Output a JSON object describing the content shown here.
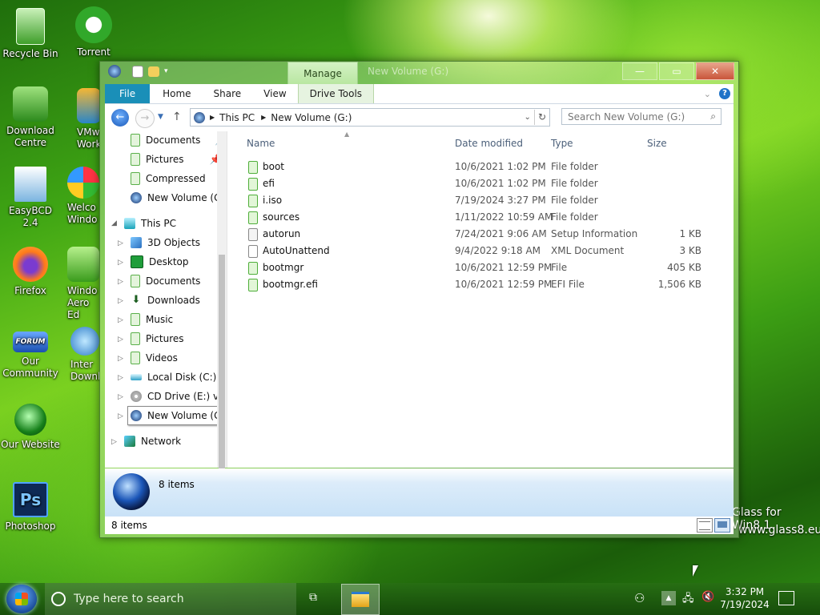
{
  "desktop": {
    "icons": [
      {
        "label": "Recycle Bin",
        "icon": "recycle-bin-icon"
      },
      {
        "label": "Torrent",
        "icon": "torrent-icon"
      },
      {
        "label": "Download Centre",
        "icon": "download-centre-icon"
      },
      {
        "label": "VMw Workst",
        "icon": "vmware-icon"
      },
      {
        "label": "EasyBCD 2.4",
        "icon": "easybcd-icon"
      },
      {
        "label": "Welco Windo",
        "icon": "welcome-icon"
      },
      {
        "label": "Firefox",
        "icon": "firefox-icon"
      },
      {
        "label": "Windo Aero Ed",
        "icon": "aero-icon"
      },
      {
        "label": "Our Community",
        "icon": "forum-icon"
      },
      {
        "label": "Inter Downl",
        "icon": "internet-download-icon"
      },
      {
        "label": "Our Website",
        "icon": "website-icon"
      },
      {
        "label": "Photoshop",
        "icon": "photoshop-icon"
      }
    ],
    "forum_badge": "FORUM",
    "ps_badge": "Ps",
    "watermark_line1": "Glass for Win8.1",
    "watermark_line2": "www.glass8.eu"
  },
  "window": {
    "title": "New Volume (G:)",
    "contextual_tab_group": "Manage",
    "ribbon_tabs": [
      "File",
      "Home",
      "Share",
      "View",
      "Drive Tools"
    ],
    "address": {
      "root": "This PC",
      "current": "New Volume (G:)"
    },
    "search_placeholder": "Search New Volume (G:)",
    "nav": {
      "quick_access": [
        "Documents",
        "Pictures",
        "Compressed",
        "New Volume (G:"
      ],
      "this_pc": "This PC",
      "this_pc_items": [
        "3D Objects",
        "Desktop",
        "Documents",
        "Downloads",
        "Music",
        "Pictures",
        "Videos",
        "Local Disk (C:)",
        "CD Drive (E:) virt",
        "New Volume (G:)"
      ],
      "network": "Network"
    },
    "columns": {
      "name": "Name",
      "date": "Date modified",
      "type": "Type",
      "size": "Size"
    },
    "files": [
      {
        "name": "boot",
        "date": "10/6/2021 1:02 PM",
        "type": "File folder",
        "size": ""
      },
      {
        "name": "efi",
        "date": "10/6/2021 1:02 PM",
        "type": "File folder",
        "size": ""
      },
      {
        "name": "i.iso",
        "date": "7/19/2024 3:27 PM",
        "type": "File folder",
        "size": ""
      },
      {
        "name": "sources",
        "date": "1/11/2022 10:59 AM",
        "type": "File folder",
        "size": ""
      },
      {
        "name": "autorun",
        "date": "7/24/2021 9:06 AM",
        "type": "Setup Information",
        "size": "1 KB"
      },
      {
        "name": "AutoUnattend",
        "date": "9/4/2022 9:18 AM",
        "type": "XML Document",
        "size": "3 KB"
      },
      {
        "name": "bootmgr",
        "date": "10/6/2021 12:59 PM",
        "type": "File",
        "size": "405 KB"
      },
      {
        "name": "bootmgr.efi",
        "date": "10/6/2021 12:59 PM",
        "type": "EFI File",
        "size": "1,506 KB"
      }
    ],
    "details_count": "8 items",
    "status_count": "8 items"
  },
  "taskbar": {
    "search_placeholder": "Type here to search",
    "time": "3:32 PM",
    "date": "7/19/2024"
  }
}
